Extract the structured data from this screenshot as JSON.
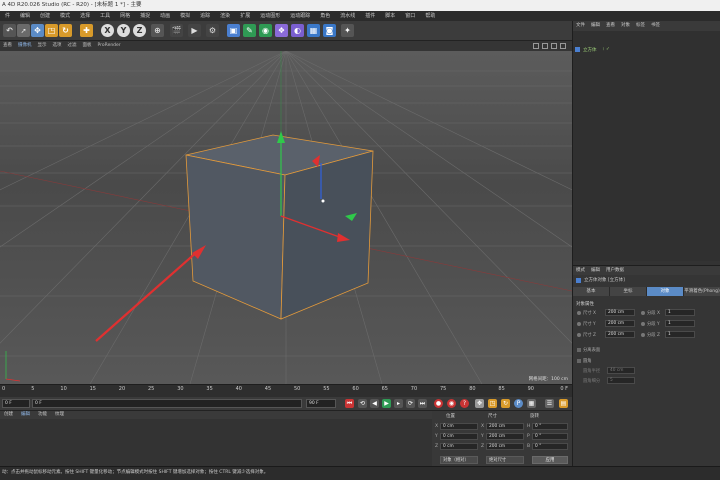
{
  "window": {
    "title": "A 4D R20.026 Studio (RC - R20) - [未标题 1 *] - 主要"
  },
  "menubar": {
    "items": [
      "件",
      "编辑",
      "创建",
      "模式",
      "选择",
      "工具",
      "网格",
      "捕捉",
      "动画",
      "模拟",
      "追踪",
      "渲染",
      "扩展",
      "运动图形",
      "运动跟踪",
      "角色",
      "流水线",
      "插件",
      "脚本",
      "窗口",
      "帮助"
    ]
  },
  "toolbar": {
    "axis_x": "X",
    "axis_y": "Y",
    "axis_z": "Z"
  },
  "viewport": {
    "menu": [
      "查看",
      "摄像机",
      "显示",
      "选项",
      "过滤",
      "面板",
      "ProRender"
    ],
    "footer": "网格间距：100 cm"
  },
  "timeline": {
    "ticks": [
      "0",
      "5",
      "10",
      "15",
      "20",
      "25",
      "30",
      "35",
      "40",
      "45",
      "50",
      "55",
      "60",
      "65",
      "70",
      "75",
      "80",
      "85",
      "90"
    ],
    "right": "0 F"
  },
  "transport": {
    "start": "0 F",
    "current": "0 F",
    "end": "90 F",
    "max": "90 F"
  },
  "material": {
    "tabs": [
      "创建",
      "编辑",
      "功能",
      "纹理"
    ]
  },
  "coords": {
    "headers": [
      "位置",
      "尺寸",
      "旋转"
    ],
    "rows": [
      {
        "axis": "X",
        "pos": "0 cm",
        "size_axis": "X",
        "size": "200 cm",
        "rot_axis": "H",
        "rot": "0 °"
      },
      {
        "axis": "Y",
        "pos": "0 cm",
        "size_axis": "Y",
        "size": "200 cm",
        "rot_axis": "P",
        "rot": "0 °"
      },
      {
        "axis": "Z",
        "pos": "0 cm",
        "size_axis": "Z",
        "size": "200 cm",
        "rot_axis": "B",
        "rot": "0 °"
      }
    ],
    "mode1": "对象（相对）",
    "mode2": "绝对尺寸",
    "apply": "应用"
  },
  "status": {
    "text": "动：点击并拖动鼠标移动元素。按住 SHIFT 键量化移动；节点编辑模式时按住 SHIFT 键增加选择对象；按住 CTRL 键减少选择对象。"
  },
  "object_manager": {
    "menu": [
      "文件",
      "编辑",
      "查看",
      "对象",
      "标签",
      "书签"
    ],
    "object_name": "立方体"
  },
  "attributes": {
    "menu": [
      "模式",
      "编辑",
      "用户数据"
    ],
    "object_label": "立方体对象 [立方体]",
    "tabs": [
      "基本",
      "坐标",
      "对象",
      "平滑着色(Phong)"
    ],
    "active_tab": 2,
    "section": "对象属性",
    "size_rows": [
      {
        "label": "尺寸 X",
        "value": "200 cm",
        "seg_label": "分段 X",
        "seg": "1"
      },
      {
        "label": "尺寸 Y",
        "value": "200 cm",
        "seg_label": "分段 Y",
        "seg": "1"
      },
      {
        "label": "尺寸 Z",
        "value": "200 cm",
        "seg_label": "分段 Z",
        "seg": "1"
      }
    ],
    "separate": "分离表面",
    "separate_val": "",
    "fillet": "圆角",
    "fillet_val": "",
    "fillet_radius_label": "圆角半径",
    "fillet_radius": "40 cm",
    "fillet_sub_label": "圆角细分",
    "fillet_sub": "5"
  },
  "colors": {
    "axis_x": "#e03030",
    "axis_y": "#2fc94a",
    "axis_z": "#3060e0",
    "accent": "#5b8bc6"
  }
}
